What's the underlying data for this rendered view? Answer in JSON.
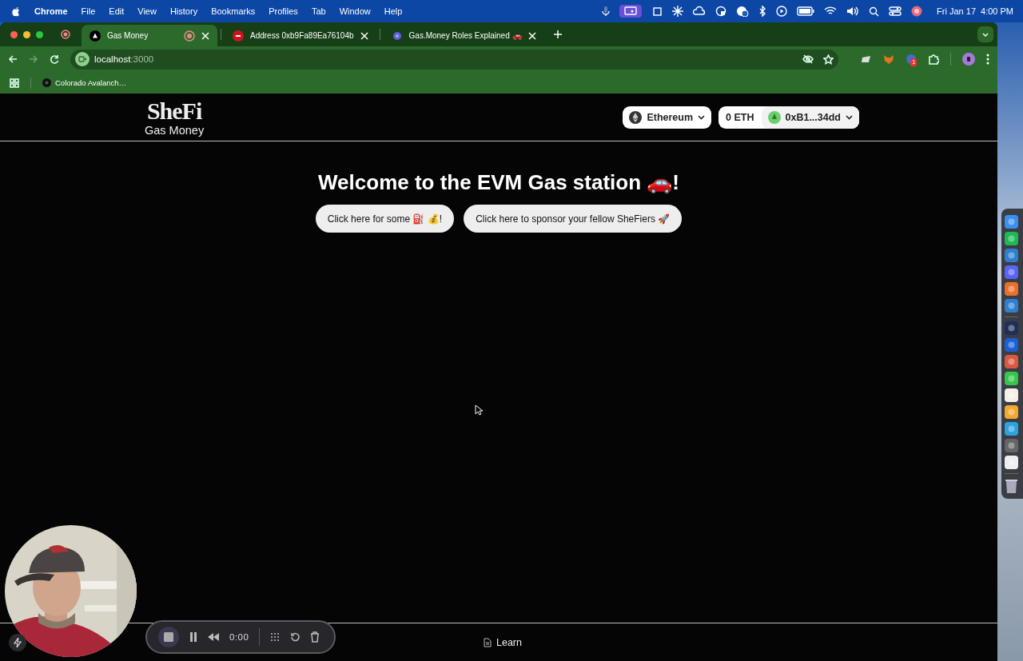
{
  "menubar": {
    "app": "Chrome",
    "items": [
      "File",
      "Edit",
      "View",
      "History",
      "Bookmarks",
      "Profiles",
      "Tab",
      "Window",
      "Help"
    ],
    "date": "Fri Jan 17",
    "time": "4:00 PM"
  },
  "tabs": [
    {
      "title": "Gas Money",
      "selected": true,
      "recording": true
    },
    {
      "title": "Address 0xb9Fa89Ea76104b",
      "selected": false,
      "recording": false
    },
    {
      "title": "Gas.Money Roles Explained 🚗",
      "selected": false,
      "recording": false
    }
  ],
  "address_bar": {
    "host": "localhost",
    "port": ":3000"
  },
  "extension_badge": "1",
  "bookmarks": [
    "Colorado Avalanch…"
  ],
  "page": {
    "logo": "SheFi",
    "subtitle": "Gas Money",
    "network": "Ethereum",
    "balance": "0 ETH",
    "account": "0xB1...34dd",
    "heading": "Welcome to the EVM Gas station 🚗!",
    "buttons": [
      "Click here for some ⛽ 💰!",
      "Click here to sponsor your fellow SheFiers 🚀"
    ],
    "footer_link": "Learn"
  },
  "recorder": {
    "time": "0:00"
  }
}
